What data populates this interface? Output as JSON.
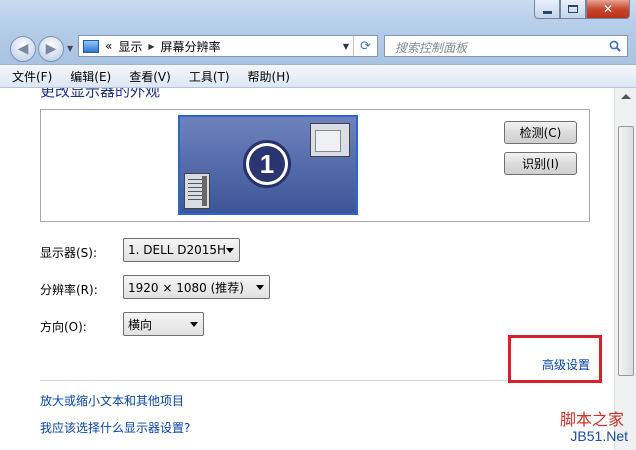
{
  "window": {
    "close_symbol": "✕"
  },
  "nav": {
    "back_symbol": "◀",
    "forward_symbol": "▶",
    "dropdown_symbol": "▼"
  },
  "address": {
    "overflow": "«",
    "crumbs": [
      "显示",
      "屏幕分辨率"
    ],
    "sep": "▶",
    "dropdown_symbol": "▼",
    "refresh_symbol": "⟳"
  },
  "search": {
    "placeholder": "搜索控制面板"
  },
  "menu": {
    "items": [
      "文件(F)",
      "编辑(E)",
      "查看(V)",
      "工具(T)",
      "帮助(H)"
    ]
  },
  "page": {
    "heading": "更改显示器的外观",
    "monitor_number": "1",
    "detect_button": "检测(C)",
    "identify_button": "识别(I)",
    "display_label": "显示器(S):",
    "display_value": "1. DELL D2015H",
    "resolution_label": "分辨率(R):",
    "resolution_value": "1920 × 1080 (推荐)",
    "orientation_label": "方向(O):",
    "orientation_value": "横向",
    "advanced_link": "高级设置",
    "link_text_size": "放大或缩小文本和其他项目",
    "link_help": "我应该选择什么显示器设置?"
  },
  "watermark": {
    "top": "脚本之家",
    "bottom": "JB51.Net"
  },
  "colors": {
    "link": "#0645ad",
    "heading": "#1e3287",
    "highlight": "#d8202a"
  }
}
